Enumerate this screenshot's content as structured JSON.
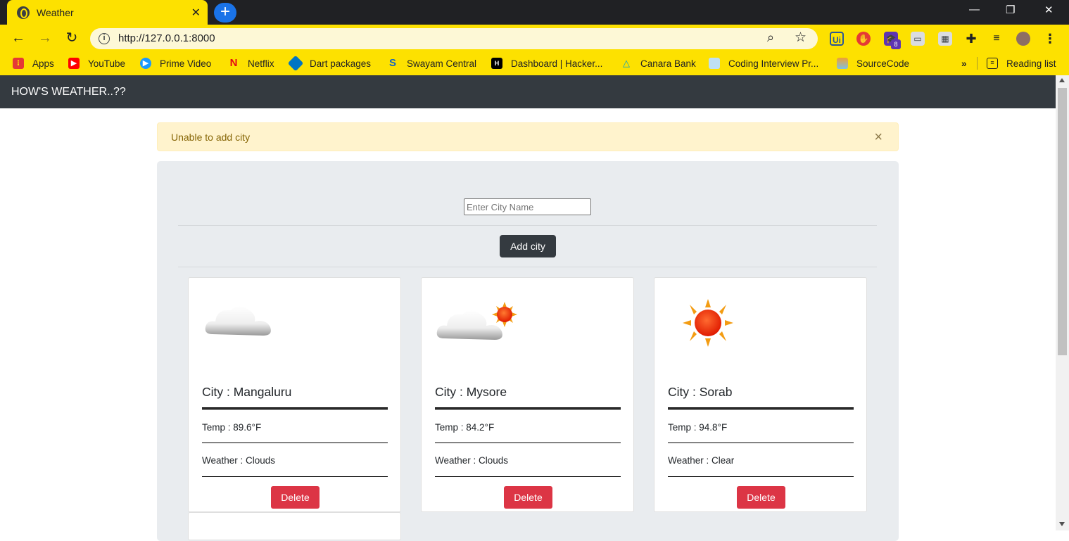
{
  "browser": {
    "tab_title": "Weather",
    "url": "http://127.0.0.1:8000",
    "extension_badge": "8",
    "bookmarks": [
      {
        "label": "Apps",
        "icon": "apps-grid-icon"
      },
      {
        "label": "YouTube",
        "icon": "youtube-icon"
      },
      {
        "label": "Prime Video",
        "icon": "prime-video-icon"
      },
      {
        "label": "Netflix",
        "icon": "netflix-icon"
      },
      {
        "label": "Dart packages",
        "icon": "dart-icon"
      },
      {
        "label": "Swayam Central",
        "icon": "swayam-icon"
      },
      {
        "label": "Dashboard | Hacker...",
        "icon": "hackerrank-icon"
      },
      {
        "label": "Canara Bank",
        "icon": "canara-bank-icon"
      },
      {
        "label": "Coding Interview Pr...",
        "icon": "folder-icon"
      },
      {
        "label": "SourceCode",
        "icon": "sourcecode-icon"
      }
    ],
    "overflow_label": "»",
    "reading_list": "Reading list",
    "theme_color": "#fde100"
  },
  "navbar": {
    "brand": "HOW'S WEATHER..??",
    "color": "#343a40"
  },
  "alert": {
    "message": "Unable to add city",
    "close": "×"
  },
  "form": {
    "placeholder": "Enter City Name",
    "value": "",
    "submit_label": "Add city"
  },
  "cards": [
    {
      "city": "City : Mangaluru",
      "temp": "Temp : 89.6°F",
      "weather": "Weather : Clouds",
      "icon": "cloud-icon",
      "delete_label": "Delete"
    },
    {
      "city": "City : Mysore",
      "temp": "Temp : 84.2°F",
      "weather": "Weather : Clouds",
      "icon": "cloud-sun-icon",
      "delete_label": "Delete"
    },
    {
      "city": "City : Sorab",
      "temp": "Temp : 94.8°F",
      "weather": "Weather : Clear",
      "icon": "sun-icon",
      "delete_label": "Delete"
    }
  ],
  "colors": {
    "delete": "#dc3545",
    "alert_bg": "#fff3cd",
    "jumbotron": "#e9ecef"
  }
}
